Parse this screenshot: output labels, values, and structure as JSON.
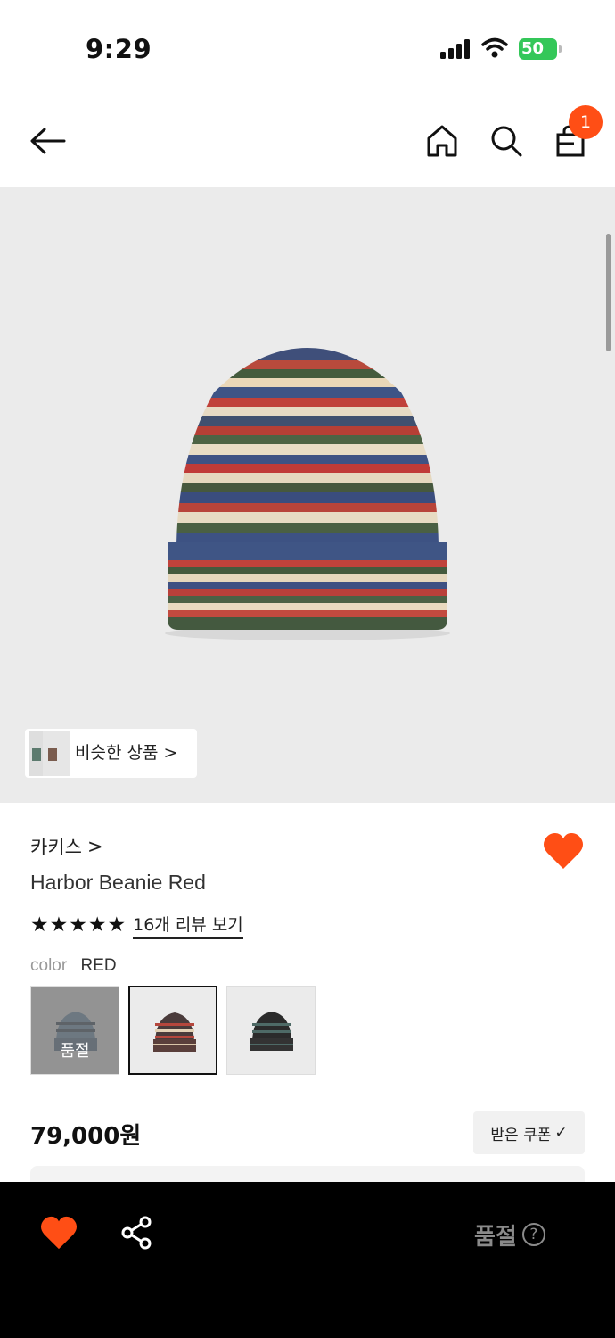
{
  "status_bar": {
    "time": "9:29",
    "battery": "50"
  },
  "nav": {
    "cart_count": "1",
    "icons": [
      "back-arrow-icon",
      "home-icon",
      "search-icon",
      "cart-icon"
    ]
  },
  "hero": {
    "similar_label": "비슷한 상품 >"
  },
  "product": {
    "brand": "카키스",
    "brand_chevron": ">",
    "name": "Harbor Beanie Red",
    "rating_stars": 5,
    "review_link": "16개 리뷰 보기",
    "color_label": "color",
    "color_value": "RED",
    "swatches": [
      {
        "variant": "blue",
        "soldout_label": "품절",
        "selected": false
      },
      {
        "variant": "red",
        "selected": true
      },
      {
        "variant": "black",
        "selected": false
      }
    ],
    "price": "79,000원",
    "coupon_label": "받은 쿠폰",
    "coupon_check": "✓"
  },
  "bottom_bar": {
    "action_label": "품절",
    "help_icon": "?"
  },
  "colors": {
    "accent": "#ff4e15",
    "hero_bg": "#ebebeb",
    "bottom_bg": "#000000",
    "battery": "#34c759"
  }
}
